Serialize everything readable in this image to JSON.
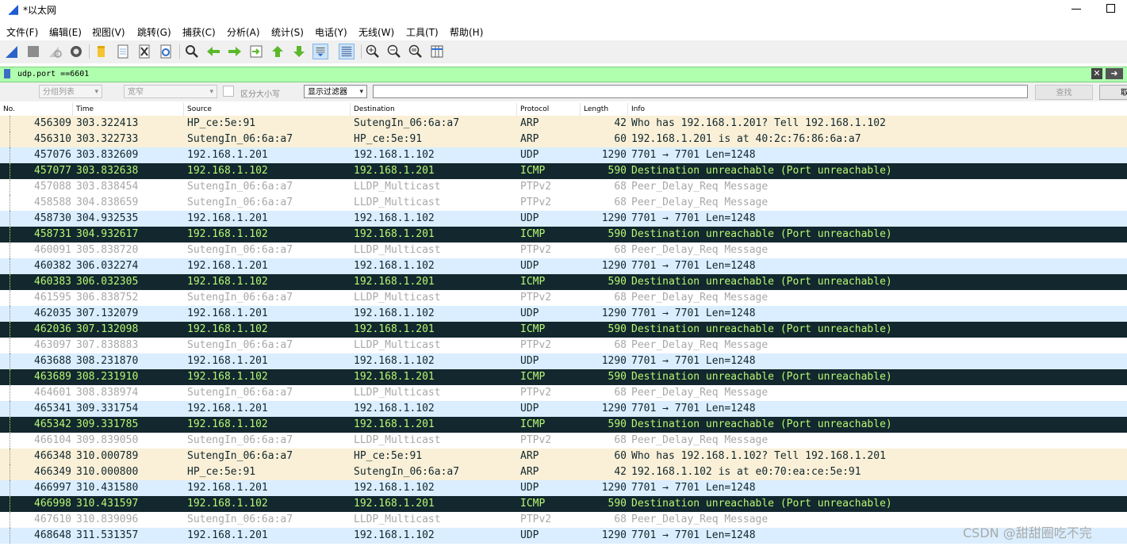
{
  "window": {
    "title": "*以太网"
  },
  "menu": [
    "文件(F)",
    "编辑(E)",
    "视图(V)",
    "跳转(G)",
    "捕获(C)",
    "分析(A)",
    "统计(S)",
    "电话(Y)",
    "无线(W)",
    "工具(T)",
    "帮助(H)"
  ],
  "toolbar_icons": [
    "shark-fin-start-icon",
    "stop-icon",
    "restart-icon",
    "options-gear-icon",
    "open-file-icon",
    "save-file-icon",
    "close-file-icon",
    "reload-icon",
    "find-icon",
    "go-back-icon",
    "go-forward-icon",
    "go-to-packet-icon",
    "first-packet-icon",
    "last-packet-icon",
    "autoscroll-icon",
    "colorize-icon",
    "zoom-in-icon",
    "zoom-out-icon",
    "normal-size-icon",
    "resize-columns-icon"
  ],
  "filter": {
    "value": "udp.port ==6601",
    "clear": "✕",
    "apply": "➜"
  },
  "search": {
    "scope": "分组列表",
    "charset": "宽窄",
    "case_label": "区分大小写",
    "type": "显示过滤器",
    "find_button": "查找",
    "cancel_button": "取消"
  },
  "columns": [
    "No.",
    "Time",
    "Source",
    "Destination",
    "Protocol",
    "Length",
    "Info"
  ],
  "colors": {
    "arp": "#faf0d7",
    "udp": "#daeeff",
    "icmp_bg": "#12272e",
    "icmp_fg": "#b7f774",
    "ptp_fg": "#a8a8a8"
  },
  "packets": [
    {
      "no": "456309",
      "time": "303.322413",
      "src": "HP_ce:5e:91",
      "dst": "SutengIn_06:6a:a7",
      "proto": "ARP",
      "len": "42",
      "info": "Who has 192.168.1.201? Tell 192.168.1.102",
      "kind": "arp"
    },
    {
      "no": "456310",
      "time": "303.322733",
      "src": "SutengIn_06:6a:a7",
      "dst": "HP_ce:5e:91",
      "proto": "ARP",
      "len": "60",
      "info": "192.168.1.201 is at 40:2c:76:86:6a:a7",
      "kind": "arp"
    },
    {
      "no": "457076",
      "time": "303.832609",
      "src": "192.168.1.201",
      "dst": "192.168.1.102",
      "proto": "UDP",
      "len": "1290",
      "info": "7701 → 7701 Len=1248",
      "kind": "udp"
    },
    {
      "no": "457077",
      "time": "303.832638",
      "src": "192.168.1.102",
      "dst": "192.168.1.201",
      "proto": "ICMP",
      "len": "590",
      "info": "Destination unreachable (Port unreachable)",
      "kind": "icmp"
    },
    {
      "no": "457088",
      "time": "303.838454",
      "src": "SutengIn_06:6a:a7",
      "dst": "LLDP_Multicast",
      "proto": "PTPv2",
      "len": "68",
      "info": "Peer_Delay_Req Message",
      "kind": "ptp"
    },
    {
      "no": "458588",
      "time": "304.838659",
      "src": "SutengIn_06:6a:a7",
      "dst": "LLDP_Multicast",
      "proto": "PTPv2",
      "len": "68",
      "info": "Peer_Delay_Req Message",
      "kind": "ptp"
    },
    {
      "no": "458730",
      "time": "304.932535",
      "src": "192.168.1.201",
      "dst": "192.168.1.102",
      "proto": "UDP",
      "len": "1290",
      "info": "7701 → 7701 Len=1248",
      "kind": "udp"
    },
    {
      "no": "458731",
      "time": "304.932617",
      "src": "192.168.1.102",
      "dst": "192.168.1.201",
      "proto": "ICMP",
      "len": "590",
      "info": "Destination unreachable (Port unreachable)",
      "kind": "icmp"
    },
    {
      "no": "460091",
      "time": "305.838720",
      "src": "SutengIn_06:6a:a7",
      "dst": "LLDP_Multicast",
      "proto": "PTPv2",
      "len": "68",
      "info": "Peer_Delay_Req Message",
      "kind": "ptp"
    },
    {
      "no": "460382",
      "time": "306.032274",
      "src": "192.168.1.201",
      "dst": "192.168.1.102",
      "proto": "UDP",
      "len": "1290",
      "info": "7701 → 7701 Len=1248",
      "kind": "udp"
    },
    {
      "no": "460383",
      "time": "306.032305",
      "src": "192.168.1.102",
      "dst": "192.168.1.201",
      "proto": "ICMP",
      "len": "590",
      "info": "Destination unreachable (Port unreachable)",
      "kind": "icmp"
    },
    {
      "no": "461595",
      "time": "306.838752",
      "src": "SutengIn_06:6a:a7",
      "dst": "LLDP_Multicast",
      "proto": "PTPv2",
      "len": "68",
      "info": "Peer_Delay_Req Message",
      "kind": "ptp"
    },
    {
      "no": "462035",
      "time": "307.132079",
      "src": "192.168.1.201",
      "dst": "192.168.1.102",
      "proto": "UDP",
      "len": "1290",
      "info": "7701 → 7701 Len=1248",
      "kind": "udp"
    },
    {
      "no": "462036",
      "time": "307.132098",
      "src": "192.168.1.102",
      "dst": "192.168.1.201",
      "proto": "ICMP",
      "len": "590",
      "info": "Destination unreachable (Port unreachable)",
      "kind": "icmp"
    },
    {
      "no": "463097",
      "time": "307.838883",
      "src": "SutengIn_06:6a:a7",
      "dst": "LLDP_Multicast",
      "proto": "PTPv2",
      "len": "68",
      "info": "Peer_Delay_Req Message",
      "kind": "ptp"
    },
    {
      "no": "463688",
      "time": "308.231870",
      "src": "192.168.1.201",
      "dst": "192.168.1.102",
      "proto": "UDP",
      "len": "1290",
      "info": "7701 → 7701 Len=1248",
      "kind": "udp"
    },
    {
      "no": "463689",
      "time": "308.231910",
      "src": "192.168.1.102",
      "dst": "192.168.1.201",
      "proto": "ICMP",
      "len": "590",
      "info": "Destination unreachable (Port unreachable)",
      "kind": "icmp"
    },
    {
      "no": "464601",
      "time": "308.838974",
      "src": "SutengIn_06:6a:a7",
      "dst": "LLDP_Multicast",
      "proto": "PTPv2",
      "len": "68",
      "info": "Peer_Delay_Req Message",
      "kind": "ptp"
    },
    {
      "no": "465341",
      "time": "309.331754",
      "src": "192.168.1.201",
      "dst": "192.168.1.102",
      "proto": "UDP",
      "len": "1290",
      "info": "7701 → 7701 Len=1248",
      "kind": "udp"
    },
    {
      "no": "465342",
      "time": "309.331785",
      "src": "192.168.1.102",
      "dst": "192.168.1.201",
      "proto": "ICMP",
      "len": "590",
      "info": "Destination unreachable (Port unreachable)",
      "kind": "icmp"
    },
    {
      "no": "466104",
      "time": "309.839050",
      "src": "SutengIn_06:6a:a7",
      "dst": "LLDP_Multicast",
      "proto": "PTPv2",
      "len": "68",
      "info": "Peer_Delay_Req Message",
      "kind": "ptp"
    },
    {
      "no": "466348",
      "time": "310.000789",
      "src": "SutengIn_06:6a:a7",
      "dst": "HP_ce:5e:91",
      "proto": "ARP",
      "len": "60",
      "info": "Who has 192.168.1.102? Tell 192.168.1.201",
      "kind": "arp"
    },
    {
      "no": "466349",
      "time": "310.000800",
      "src": "HP_ce:5e:91",
      "dst": "SutengIn_06:6a:a7",
      "proto": "ARP",
      "len": "42",
      "info": "192.168.1.102 is at e0:70:ea:ce:5e:91",
      "kind": "arp"
    },
    {
      "no": "466997",
      "time": "310.431580",
      "src": "192.168.1.201",
      "dst": "192.168.1.102",
      "proto": "UDP",
      "len": "1290",
      "info": "7701 → 7701 Len=1248",
      "kind": "udp"
    },
    {
      "no": "466998",
      "time": "310.431597",
      "src": "192.168.1.102",
      "dst": "192.168.1.201",
      "proto": "ICMP",
      "len": "590",
      "info": "Destination unreachable (Port unreachable)",
      "kind": "icmp"
    },
    {
      "no": "467610",
      "time": "310.839096",
      "src": "SutengIn_06:6a:a7",
      "dst": "LLDP_Multicast",
      "proto": "PTPv2",
      "len": "68",
      "info": "Peer_Delay_Req Message",
      "kind": "ptp"
    },
    {
      "no": "468648",
      "time": "311.531357",
      "src": "192.168.1.201",
      "dst": "192.168.1.102",
      "proto": "UDP",
      "len": "1290",
      "info": "7701 → 7701 Len=1248",
      "kind": "udp"
    }
  ],
  "watermark": "CSDN @甜甜圈吃不完"
}
